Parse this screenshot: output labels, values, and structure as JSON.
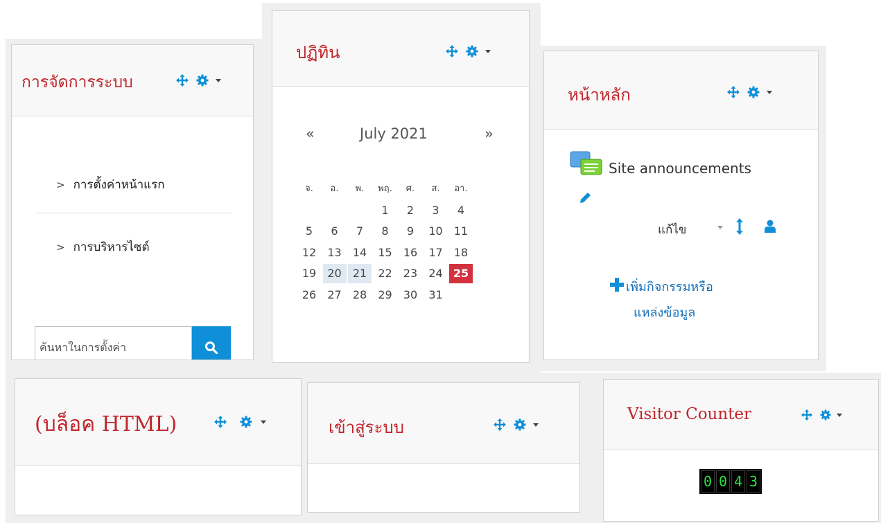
{
  "colors": {
    "title_red": "#c0262c",
    "accent_blue": "#0f8fd8",
    "today_red": "#d4313f",
    "week_highlight": "#dfe9f2",
    "counter_green": "#27e83b"
  },
  "admin_block": {
    "title": "การจัดการระบบ",
    "items": [
      {
        "label": "การตั้งค่าหน้าแรก"
      },
      {
        "label": "การบริหารไซต์"
      }
    ],
    "search_placeholder": "ค้นหาในการตั้งค่า",
    "search_icon": "search-icon"
  },
  "calendar_block": {
    "title": "ปฏิทิน",
    "prev": "«",
    "next": "»",
    "month_label": "July 2021",
    "weekdays": [
      "จ.",
      "อ.",
      "พ.",
      "พฤ.",
      "ศ.",
      "ส.",
      "อา."
    ],
    "weeks": [
      [
        "",
        "",
        "",
        "1",
        "2",
        "3",
        "4"
      ],
      [
        "5",
        "6",
        "7",
        "8",
        "9",
        "10",
        "11"
      ],
      [
        "12",
        "13",
        "14",
        "15",
        "16",
        "17",
        "18"
      ],
      [
        "19",
        "20",
        "21",
        "22",
        "23",
        "24",
        "25"
      ],
      [
        "26",
        "27",
        "28",
        "29",
        "30",
        "31",
        ""
      ]
    ],
    "highlighted_days": [
      "20",
      "21"
    ],
    "today": "25"
  },
  "main_block": {
    "title": "หน้าหลัก",
    "forum_icon": "forum-icon",
    "forum_label": "Site announcements",
    "edit_label": "แก้ไข",
    "add_activity_line1": "เพิ่มกิจกรรมหรือ",
    "add_activity_line2": "แหล่งข้อมูล"
  },
  "html_block": {
    "title": "(บล็อค HTML)"
  },
  "login_block": {
    "title": "เข้าสู่ระบบ"
  },
  "visitor_block": {
    "title": "Visitor Counter",
    "digits": [
      "0",
      "0",
      "4",
      "3"
    ]
  }
}
